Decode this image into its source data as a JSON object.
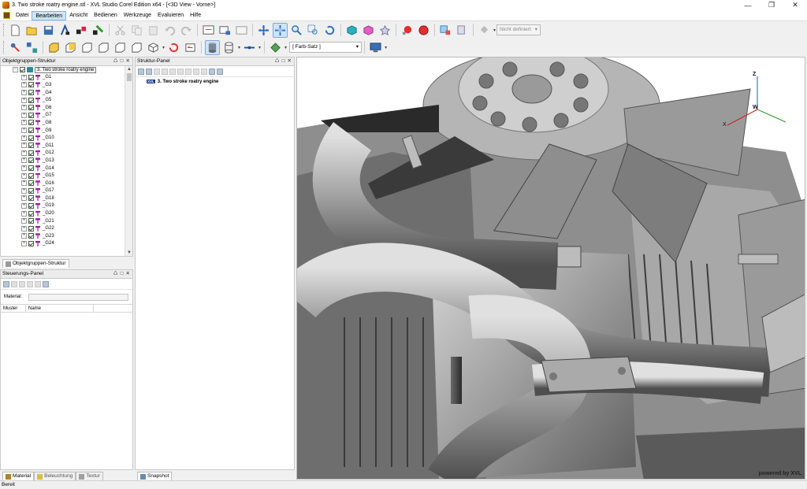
{
  "window": {
    "title": "3. Two stroke roatry engine.stl - XVL Studio Corel Edition x64 - [<3D View - Vorne>]"
  },
  "menu": [
    "Datei",
    "Bearbeiten",
    "Ansicht",
    "Bedienen",
    "Werkzeuge",
    "Evaluieren",
    "Hilfe"
  ],
  "menu_active_index": 1,
  "toolbar": {
    "material_combo": "Nicht definiert",
    "color_combo": "[ Farb-Satz ]"
  },
  "object_panel": {
    "title": "Objektgruppen-Struktur",
    "root_label": "3. Two stroke roatry engine",
    "groups": [
      "_G1",
      "_G3",
      "_G4",
      "_G5",
      "_G6",
      "_G7",
      "_G8",
      "_G9",
      "_G10",
      "_G11",
      "_G12",
      "_G13",
      "_G14",
      "_G15",
      "_G16",
      "_G17",
      "_G18",
      "_G19",
      "_G20",
      "_G21",
      "_G22",
      "_G23",
      "_G24"
    ],
    "tab": "Objektgruppen-Struktur"
  },
  "control_panel": {
    "title": "Steuerungs-Panel",
    "material_label": "Material:",
    "columns": [
      "Muster",
      "Name"
    ],
    "tabs": [
      "Material",
      "Beleuchtung",
      "Textur"
    ]
  },
  "structure_panel": {
    "title": "Struktur-Panel",
    "root_badge": "XVL",
    "root_label": "3. Two stroke roatry engine",
    "tab": "Snapshot"
  },
  "viewport": {
    "view_label": "3D View - Vorne",
    "axis_labels": [
      "Z",
      "W",
      "X"
    ],
    "powered_by": "powered by XVL"
  },
  "status": "Bereit"
}
